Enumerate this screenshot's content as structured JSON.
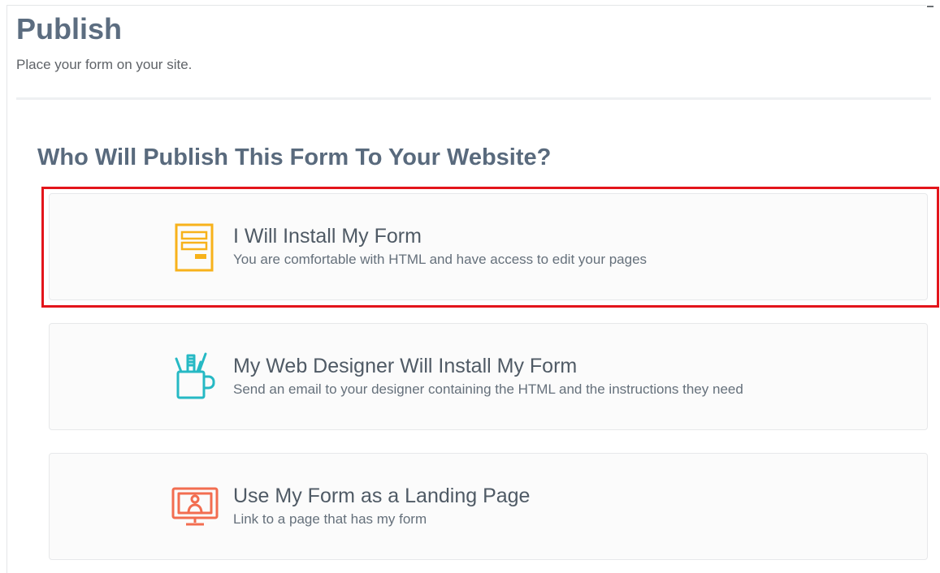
{
  "page": {
    "title": "Publish",
    "subtitle": "Place your form on your site."
  },
  "section": {
    "heading": "Who Will Publish This Form To Your Website?"
  },
  "options": [
    {
      "title": "I Will Install My Form",
      "description": "You are comfortable with HTML and have access to edit your pages",
      "icon": "form-document-icon",
      "icon_color": "#f7b21b",
      "selected": true
    },
    {
      "title": "My Web Designer Will Install My Form",
      "description": "Send an email to your designer containing the HTML and the instructions they need",
      "icon": "designer-mug-icon",
      "icon_color": "#26b9c4",
      "selected": false
    },
    {
      "title": "Use My Form as a Landing Page",
      "description": "Link to a page that has my form",
      "icon": "landing-page-monitor-icon",
      "icon_color": "#f26d50",
      "selected": false
    }
  ],
  "colors": {
    "selection_outline": "#e3151b",
    "title_text": "#5c6d80"
  }
}
